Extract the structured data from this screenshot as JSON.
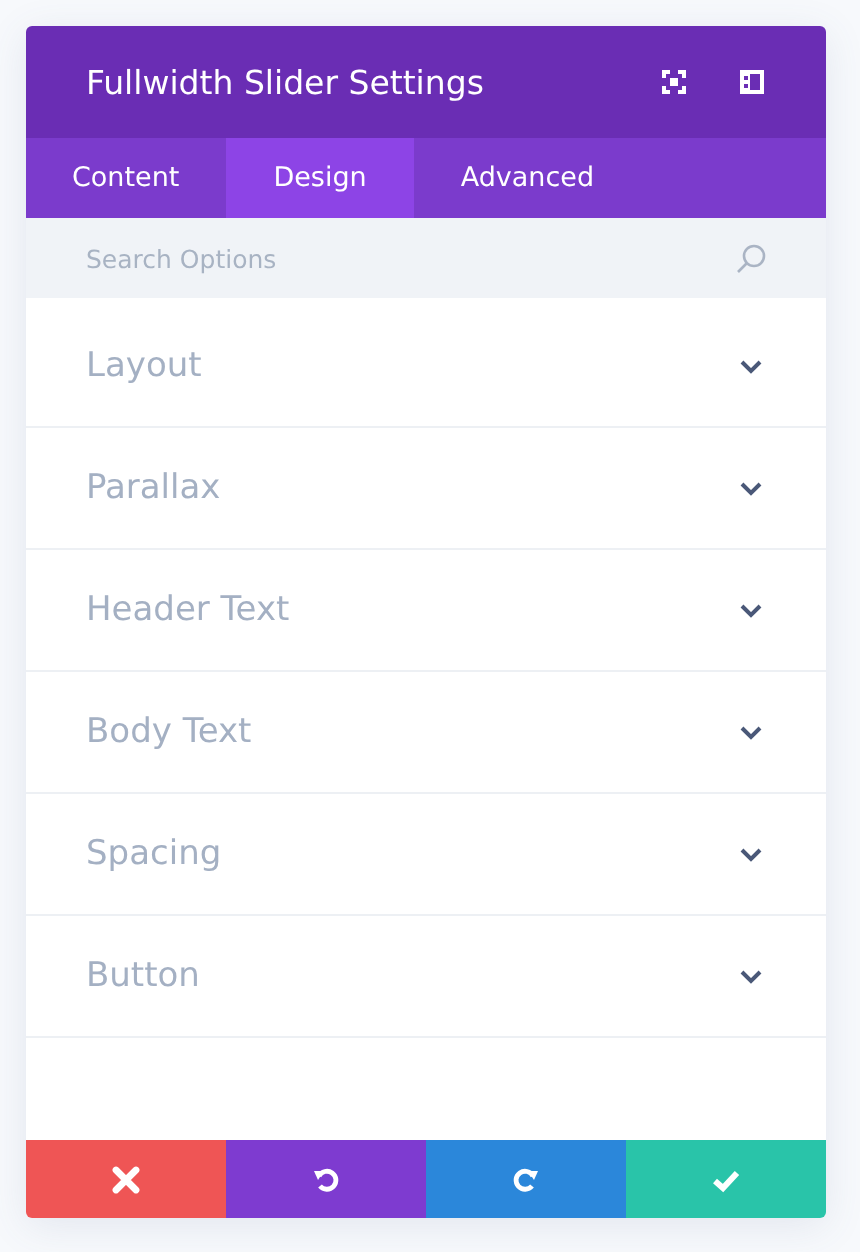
{
  "window": {
    "title": "Fullwidth Slider Settings"
  },
  "tabs": [
    {
      "label": "Content",
      "selected": false
    },
    {
      "label": "Design",
      "selected": true
    },
    {
      "label": "Advanced",
      "selected": false
    }
  ],
  "search": {
    "placeholder": "Search Options"
  },
  "sections": [
    {
      "label": "Layout",
      "expanded": false
    },
    {
      "label": "Parallax",
      "expanded": false
    },
    {
      "label": "Header Text",
      "expanded": false
    },
    {
      "label": "Body Text",
      "expanded": false
    },
    {
      "label": "Spacing",
      "expanded": false
    },
    {
      "label": "Button",
      "expanded": false
    }
  ],
  "footer_buttons": [
    {
      "kind": "cancel"
    },
    {
      "kind": "undo"
    },
    {
      "kind": "redo"
    },
    {
      "kind": "save"
    }
  ]
}
